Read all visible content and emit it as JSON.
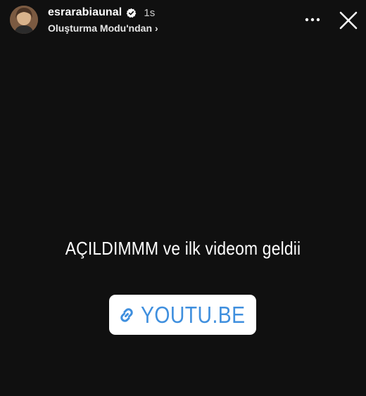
{
  "header": {
    "username": "esrarabiaunal",
    "verified": true,
    "time_ago": "1s",
    "source_label": "Oluşturma Modu'ndan",
    "source_chevron": "›",
    "more_icon": "more-horizontal-icon",
    "close_icon": "close-icon"
  },
  "story": {
    "caption": "AÇILDIMMM ve ilk videom geldii",
    "link_sticker": {
      "label": "YOUTU.BE",
      "icon": "link-icon"
    }
  },
  "colors": {
    "background": "#101010",
    "link_text": "#3f8fde",
    "verified_badge": "#ffffff"
  }
}
